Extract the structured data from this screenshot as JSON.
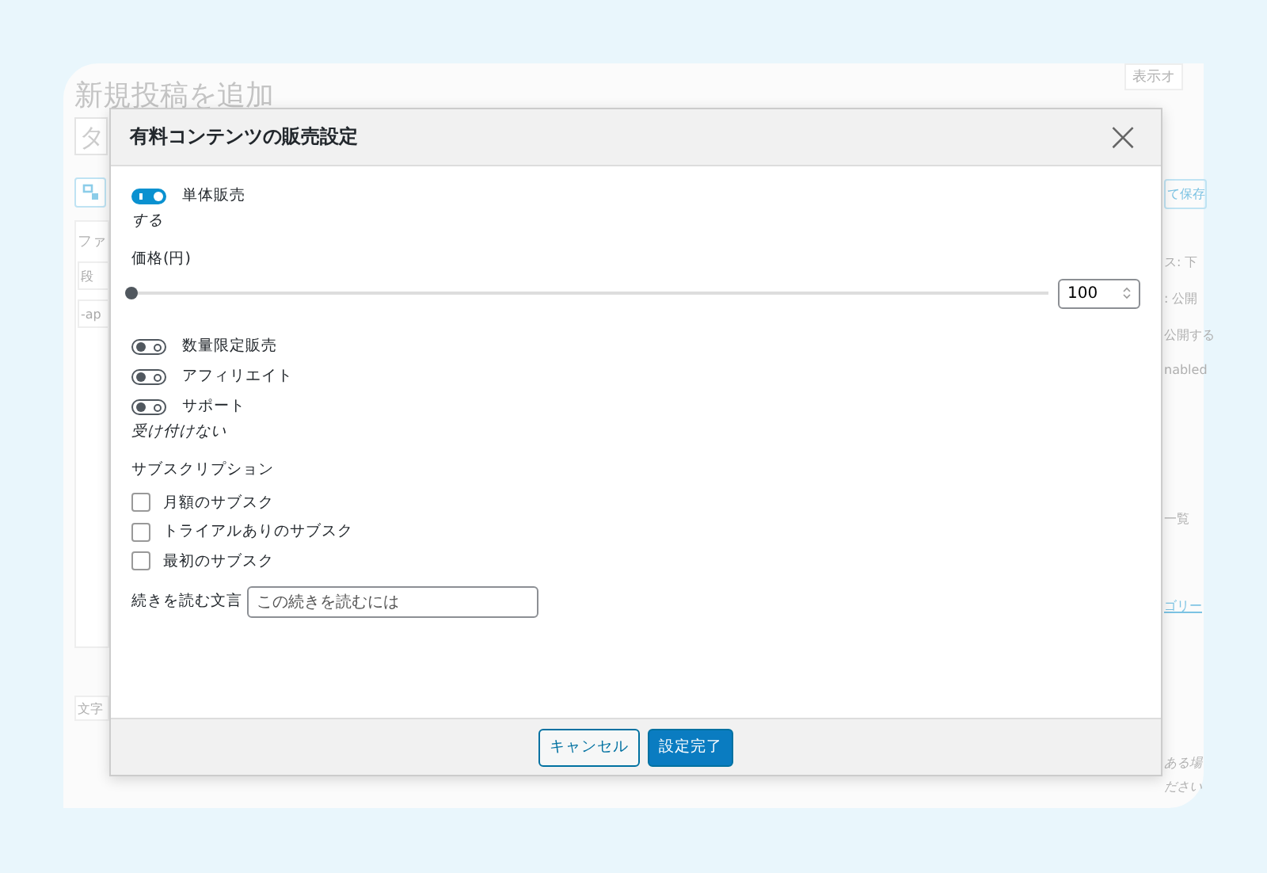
{
  "editor": {
    "page_title": "新規投稿を追加",
    "title_field": {
      "placeholder": "タ"
    },
    "block_label": "ファ",
    "block_fields": [
      {
        "value": "段"
      },
      {
        "value": "-ap"
      }
    ],
    "footer_label": "文字",
    "sidebar": {
      "options_tab": "表示オ",
      "save_button": "て保存",
      "lines": [
        "ス: 下",
        ": 公開",
        "公開する",
        "nabled"
      ],
      "list_tab": "一覧",
      "category_link": "ゴリー",
      "hint_lines": [
        "ある場",
        "ださい"
      ]
    }
  },
  "dialog": {
    "title": "有料コンテンツの販売設定",
    "close": "×",
    "single_sale": {
      "label": "単体販売",
      "on": true,
      "note": "する"
    },
    "price": {
      "label": "価格(円)",
      "level": 0,
      "value": "100"
    },
    "toggles": [
      {
        "label": "数量限定販売",
        "on": false
      },
      {
        "label": "アフィリエイト",
        "on": false
      },
      {
        "label": "サポート",
        "on": false,
        "note": "受け付けない"
      }
    ],
    "subscription": {
      "heading": "サブスクリプション",
      "options": [
        {
          "label": "月額のサブスク",
          "checked": false
        },
        {
          "label": "トライアルありのサブスク",
          "checked": false
        },
        {
          "label": "最初のサブスク",
          "checked": false
        }
      ]
    },
    "read_more": {
      "label": "続きを読む文言",
      "value": "この続きを読むには"
    },
    "buttons": [
      {
        "label": "キャンセル",
        "kind": "secondary"
      },
      {
        "label": "設定完了",
        "kind": "primary"
      }
    ]
  }
}
